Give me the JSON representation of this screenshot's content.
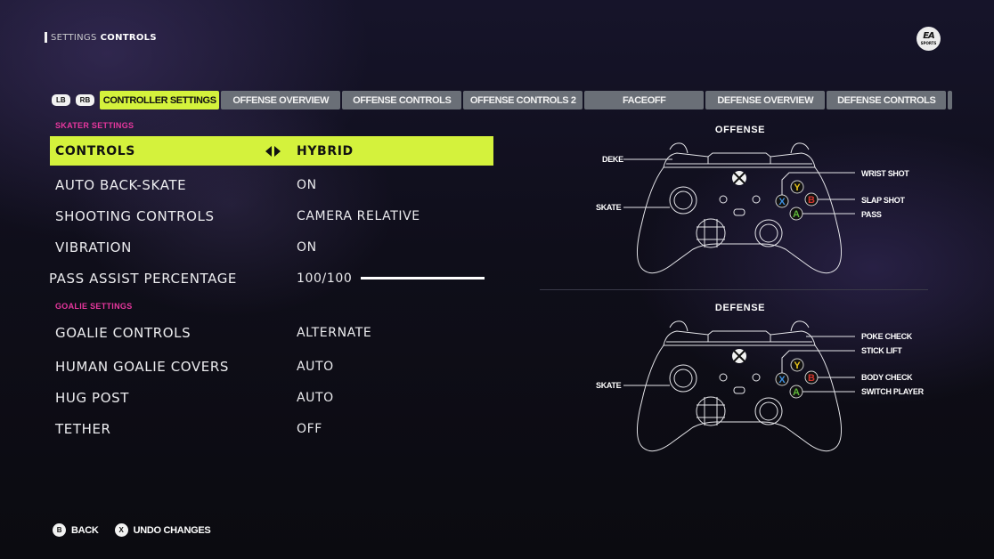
{
  "header": {
    "breadcrumb": [
      "SETTINGS",
      "CONTROLS"
    ],
    "logo": {
      "line1": "EA",
      "line2": "SPORTS"
    }
  },
  "tabs": {
    "bumpers": [
      "LB",
      "RB"
    ],
    "items": [
      {
        "label": "CONTROLLER SETTINGS",
        "active": true
      },
      {
        "label": "OFFENSE OVERVIEW",
        "active": false
      },
      {
        "label": "OFFENSE CONTROLS",
        "active": false
      },
      {
        "label": "OFFENSE CONTROLS 2",
        "active": false
      },
      {
        "label": "FACEOFF",
        "active": false
      },
      {
        "label": "DEFENSE OVERVIEW",
        "active": false
      },
      {
        "label": "DEFENSE CONTROLS",
        "active": false
      }
    ]
  },
  "skater": {
    "title": "SKATER SETTINGS",
    "rows": [
      {
        "label": "CONTROLS",
        "value": "HYBRID",
        "selected": true
      },
      {
        "label": "AUTO BACK-SKATE",
        "value": "ON"
      },
      {
        "label": "SHOOTING CONTROLS",
        "value": "CAMERA RELATIVE"
      },
      {
        "label": "VIBRATION",
        "value": "ON"
      },
      {
        "label": "PASS ASSIST PERCENTAGE",
        "value": "100/100",
        "slider_percent": 100
      }
    ]
  },
  "goalie": {
    "title": "GOALIE SETTINGS",
    "rows": [
      {
        "label": "GOALIE CONTROLS",
        "value": "ALTERNATE"
      },
      {
        "label": "HUMAN GOALIE COVERS",
        "value": "AUTO"
      },
      {
        "label": "HUG POST",
        "value": "AUTO"
      },
      {
        "label": "TETHER",
        "value": "OFF"
      }
    ]
  },
  "controllers": {
    "offense": {
      "title": "OFFENSE",
      "callouts": {
        "lb": "DEKE",
        "ls": "SKATE",
        "x": "WRIST SHOT",
        "b": "SLAP SHOT",
        "a": "PASS"
      }
    },
    "defense": {
      "title": "DEFENSE",
      "callouts": {
        "ls": "SKATE",
        "rb": "POKE CHECK",
        "x": "STICK LIFT",
        "b": "BODY CHECK",
        "a": "SWITCH PLAYER"
      }
    },
    "face_buttons": {
      "y": "Y",
      "x": "X",
      "b": "B",
      "a": "A"
    },
    "colors": {
      "y": "#e6c21a",
      "x": "#3d8fe0",
      "b": "#d2352e",
      "a": "#5fb83a"
    }
  },
  "footer": {
    "hints": [
      {
        "button": "B",
        "label": "BACK"
      },
      {
        "button": "X",
        "label": "UNDO CHANGES"
      }
    ]
  },
  "theme": {
    "accent": "#d4f23c",
    "section": "#e8379e",
    "tab_inactive": "#6a6f77"
  }
}
